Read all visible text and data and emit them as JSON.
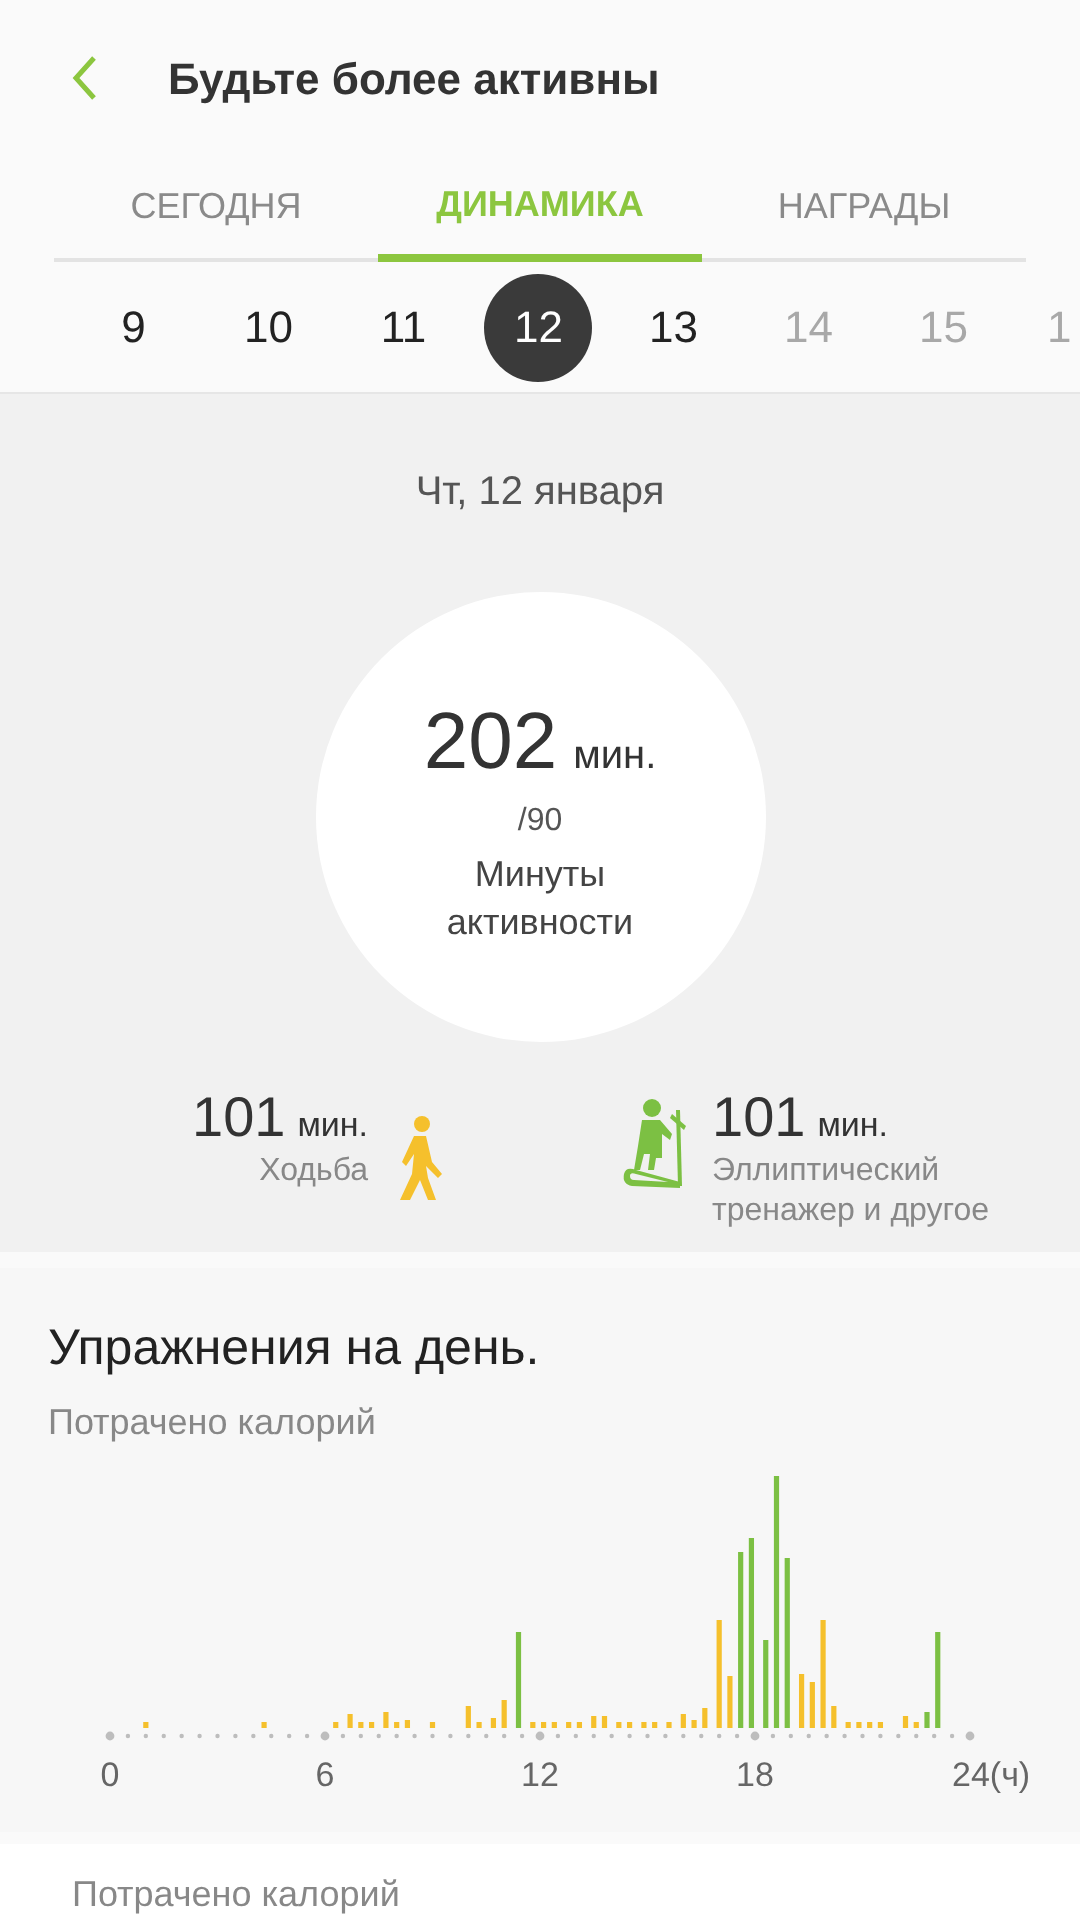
{
  "header": {
    "title": "Будьте более активны"
  },
  "tabs": [
    {
      "label": "СЕГОДНЯ",
      "selected": false
    },
    {
      "label": "ДИНАМИКА",
      "selected": true
    },
    {
      "label": "НАГРАДЫ",
      "selected": false
    }
  ],
  "dates": [
    {
      "label": "9",
      "selected": false,
      "disabled": false
    },
    {
      "label": "10",
      "selected": false,
      "disabled": false
    },
    {
      "label": "11",
      "selected": false,
      "disabled": false
    },
    {
      "label": "12",
      "selected": true,
      "disabled": false
    },
    {
      "label": "13",
      "selected": false,
      "disabled": false
    },
    {
      "label": "14",
      "selected": false,
      "disabled": true
    },
    {
      "label": "15",
      "selected": false,
      "disabled": true
    },
    {
      "label": "1",
      "selected": false,
      "disabled": true
    }
  ],
  "day": {
    "date": "Чт, 12 января",
    "total": "202",
    "unit": "мин.",
    "goal": "/90",
    "caption": "Минуты активности"
  },
  "activities": [
    {
      "kind": "walking",
      "value": "101",
      "unit": "мин.",
      "label": "Ходьба"
    },
    {
      "kind": "elliptical",
      "value": "101",
      "unit": "мин.",
      "label": "Эллиптический тренажер и другое"
    }
  ],
  "exercise": {
    "title": "Упражнения на день.",
    "subtitle": "Потрачено калорий",
    "axis_labels": [
      "0",
      "6",
      "12",
      "18",
      "24(ч)"
    ]
  },
  "footer": {
    "label": "Потрачено калорий"
  }
}
